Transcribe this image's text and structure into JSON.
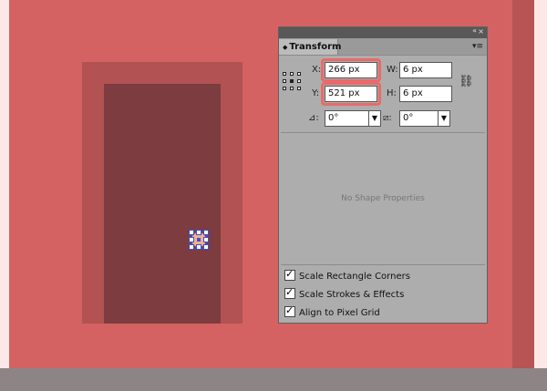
{
  "panel": {
    "collapse_icon": "«",
    "close_icon": "×",
    "tab_arrow": "◆",
    "tab_title": "Transform",
    "menu_icon": "▾≡",
    "x_label": "X:",
    "x_value": "266 px",
    "y_label": "Y:",
    "y_value": "521 px",
    "w_label": "W:",
    "w_value": "6 px",
    "h_label": "H:",
    "h_value": "6 px",
    "rotate_label": "⊿:",
    "rotate_value": "0°",
    "shear_label": "⧄:",
    "shear_value": "0°",
    "dropdown_icon": "▼",
    "link_icon": "⛓",
    "no_shape": "No Shape Properties",
    "checkboxes": [
      {
        "label": "Scale Rectangle Corners",
        "checked": true
      },
      {
        "label": "Scale Strokes & Effects",
        "checked": true
      },
      {
        "label": "Align to Pixel Grid",
        "checked": true
      }
    ]
  },
  "colors": {
    "canvas": "#d46262",
    "door_frame": "#b25252",
    "door_panel": "#7d3c3f",
    "knob": "#f1b18b",
    "selection": "#3a4fd6",
    "highlight": "#ea6a6a"
  }
}
